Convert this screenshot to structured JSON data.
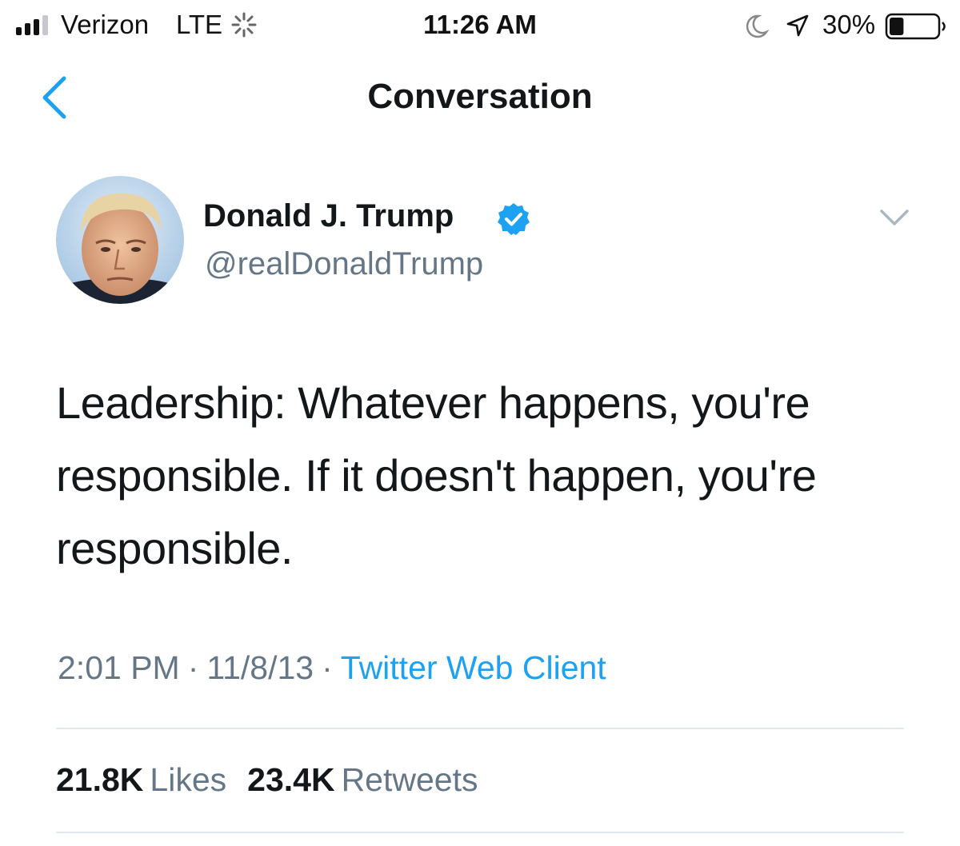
{
  "status_bar": {
    "carrier": "Verizon",
    "network": "LTE",
    "time": "11:26 AM",
    "battery_percent": "30%",
    "battery_level": 0.3,
    "icons": [
      "signal-icon",
      "activity-spinner-icon",
      "moon-icon",
      "location-arrow-icon",
      "battery-icon"
    ]
  },
  "nav": {
    "title": "Conversation",
    "back_icon": "chevron-left-icon"
  },
  "tweet": {
    "display_name": "Donald J. Trump",
    "handle": "@realDonaldTrump",
    "verified": true,
    "text": "Leadership: Whatever happens, you're responsible. If it doesn't happen, you're responsible.",
    "time": "2:01 PM",
    "date": "11/8/13",
    "separator": "·",
    "client": "Twitter Web Client",
    "likes_count": "21.8K",
    "likes_label": "Likes",
    "retweets_count": "23.4K",
    "retweets_label": "Retweets"
  },
  "colors": {
    "accent": "#1da1f2",
    "secondary_text": "#657786",
    "divider": "#e1e8ed"
  }
}
